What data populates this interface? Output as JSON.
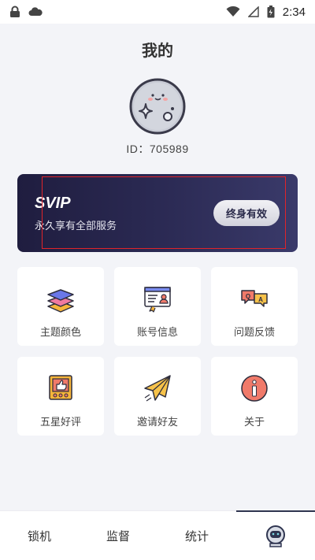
{
  "status_bar": {
    "time": "2:34"
  },
  "header": {
    "title": "我的"
  },
  "profile": {
    "id_label": "ID：705989"
  },
  "svip": {
    "title": "SVIP",
    "subtitle": "永久享有全部服务",
    "button_label": "终身有效"
  },
  "grid": {
    "items": [
      {
        "label": "主题颜色",
        "icon": "layers-icon"
      },
      {
        "label": "账号信息",
        "icon": "account-card-icon"
      },
      {
        "label": "问题反馈",
        "icon": "qa-bubbles-icon"
      },
      {
        "label": "五星好评",
        "icon": "thumbs-up-stars-icon"
      },
      {
        "label": "邀请好友",
        "icon": "paper-plane-icon"
      },
      {
        "label": "关于",
        "icon": "info-icon"
      }
    ]
  },
  "bottom_nav": {
    "items": [
      {
        "label": "锁机"
      },
      {
        "label": "监督"
      },
      {
        "label": "统计"
      },
      {
        "label": "",
        "icon": "astronaut-icon"
      }
    ],
    "active_index": 3
  }
}
